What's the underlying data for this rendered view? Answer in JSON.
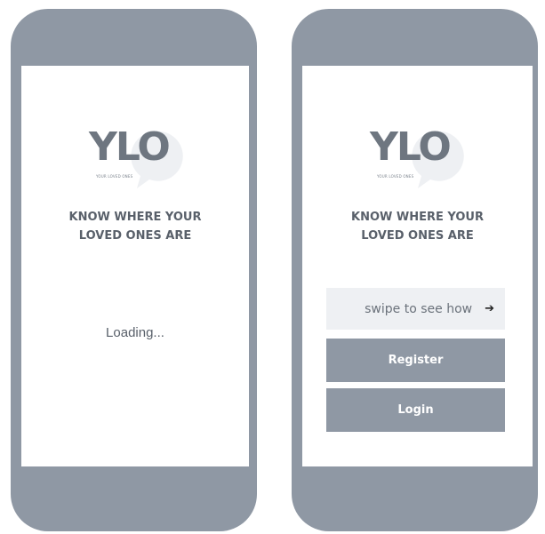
{
  "logo": {
    "text": "YLO",
    "subtitle": "YOUR LOVED ONES"
  },
  "tagline": {
    "line1": "KNOW WHERE YOUR",
    "line2": "LOVED ONES ARE"
  },
  "loading_screen": {
    "status": "Loading..."
  },
  "welcome_screen": {
    "swipe_label": "swipe to see how",
    "swipe_arrow": "➔",
    "register_label": "Register",
    "login_label": "Login"
  },
  "colors": {
    "phone_frame": "#8f98a4",
    "screen_bg": "#ffffff",
    "logo_grey": "#6e7680",
    "swipe_bg": "#eef0f3",
    "button_bg": "#8f98a4"
  }
}
